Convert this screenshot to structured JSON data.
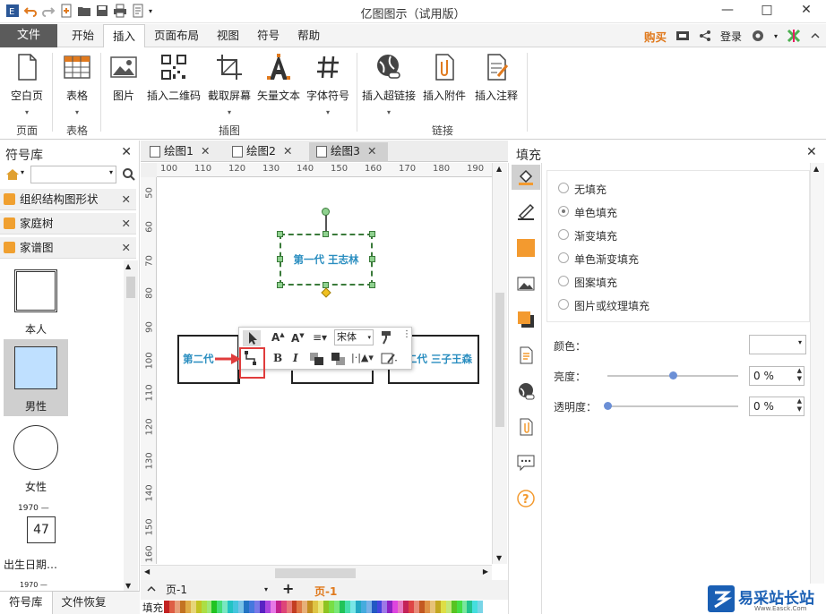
{
  "app": {
    "title": "亿图图示（试用版）",
    "window_controls": [
      "—",
      "□",
      "✕"
    ]
  },
  "menu": {
    "file": "文件",
    "tabs": [
      "开始",
      "插入",
      "页面布局",
      "视图",
      "符号",
      "帮助"
    ],
    "active_tab": "插入",
    "buy": "购买",
    "login": "登录"
  },
  "ribbon": {
    "buttons": {
      "blank_page": "空白页",
      "table": "表格",
      "image": "图片",
      "qr": "插入二维码",
      "screenshot": "截取屏幕",
      "vector_text": "矢量文本",
      "font_symbol": "字体符号",
      "hyperlink": "插入超链接",
      "attachment": "插入附件",
      "note": "插入注释"
    },
    "groups": {
      "page": "页面",
      "table": "表格",
      "illustration": "插图",
      "link": "链接"
    }
  },
  "library": {
    "title": "符号库",
    "categories": [
      "组织结构图形状",
      "家庭树",
      "家谱图"
    ],
    "shapes": [
      "本人",
      "男性",
      "女性",
      "出生日期…"
    ],
    "shape_badge_year": "1970 —",
    "shape_badge_num": "47",
    "shape_badge_year2": "1970 —",
    "bottom_tabs": [
      "符号库",
      "文件恢复"
    ]
  },
  "doc_tabs": [
    "绘图1",
    "绘图2",
    "绘图3"
  ],
  "ruler": {
    "h": [
      "100",
      "110",
      "120",
      "130",
      "140",
      "150",
      "160",
      "170",
      "180",
      "190"
    ],
    "v": [
      "50",
      "60",
      "70",
      "80",
      "90",
      "100",
      "110",
      "120",
      "130",
      "140",
      "150",
      "160"
    ]
  },
  "canvas": {
    "top_box": "第一代 王志林",
    "left_box": "第二代 ",
    "right_box": "二代 三子王森"
  },
  "float_toolbar": {
    "font": "宋体"
  },
  "page_bar": {
    "page_select": "页-1",
    "add": "+",
    "current_page": "页-1",
    "fill_label": "填充"
  },
  "fill_panel": {
    "title": "填充",
    "options": [
      "无填充",
      "单色填充",
      "渐变填充",
      "单色渐变填充",
      "图案填充",
      "图片或纹理填充"
    ],
    "selected_option": "单色填充",
    "color_label": "颜色：",
    "brightness_label": "亮度：",
    "brightness_value": "0 %",
    "brightness_level": 0.5,
    "transparency_label": "透明度：",
    "transparency_value": "0 %",
    "transparency_level": 0.0
  },
  "watermark": {
    "text": "易采站长站",
    "sub": "Www.Easck.Com"
  },
  "colors": {
    "accent_blue": "#2a8ec0",
    "buy_orange": "#e0791c",
    "file_tab": "#5b5b5b",
    "selection_fill": "#bfe0ff",
    "arrow_red": "#e03c3c"
  }
}
